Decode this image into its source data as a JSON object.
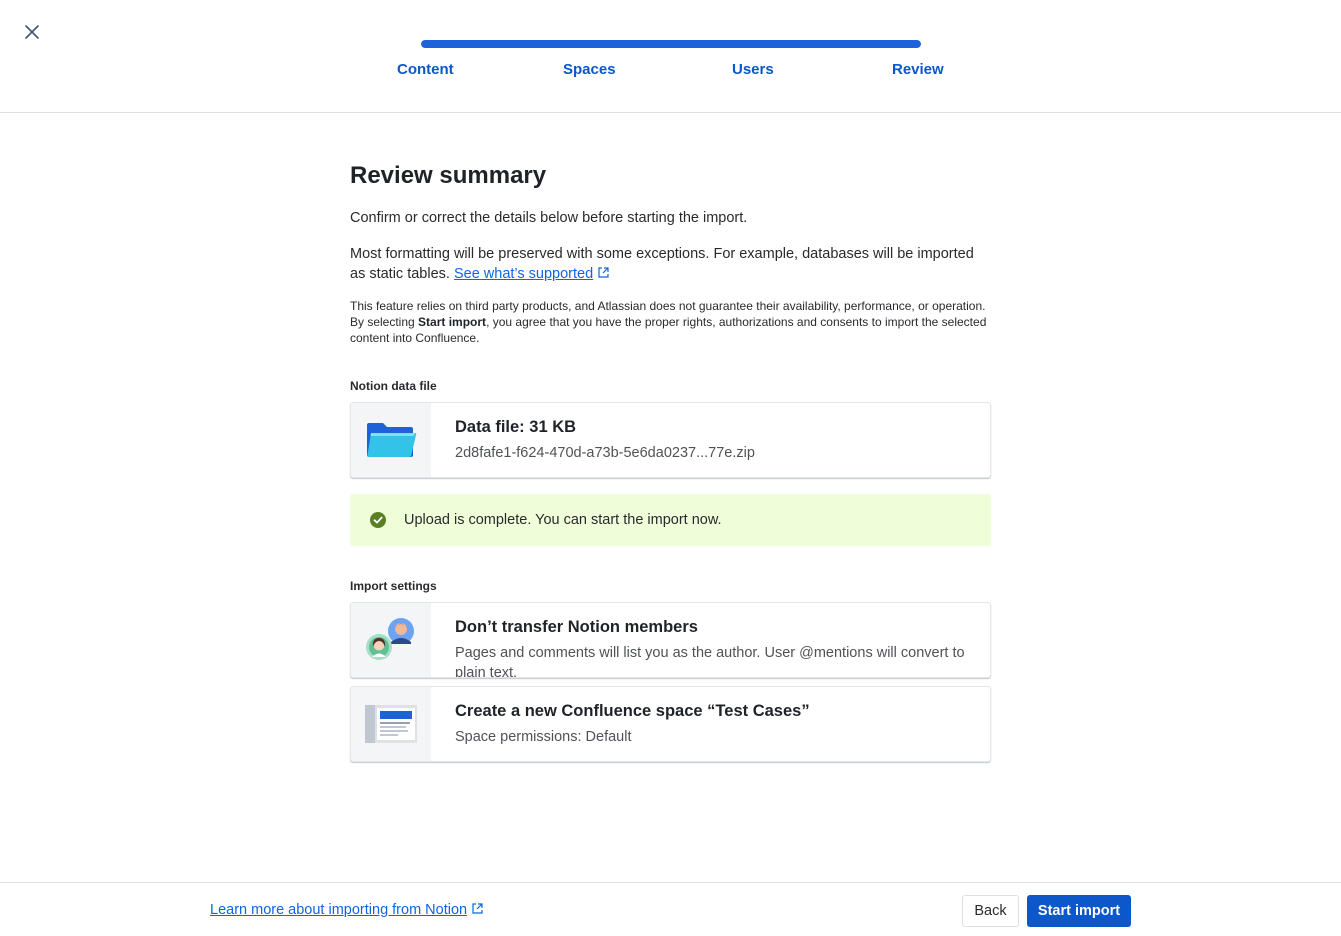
{
  "header": {
    "close_icon": "close-icon",
    "progress_percent": 100,
    "steps": [
      {
        "label": "Content"
      },
      {
        "label": "Spaces"
      },
      {
        "label": "Users"
      },
      {
        "label": "Review"
      }
    ]
  },
  "main": {
    "title": "Review summary",
    "intro": "Confirm or correct the details below before starting the import.",
    "formatting_note": "Most formatting will be preserved with some exceptions. For example, databases will be imported as static tables.",
    "supported_link": "See what’s supported",
    "disclaimer_before": "This feature relies on third party products, and Atlassian does not guarantee their availability, performance, or operation. By selecting ",
    "disclaimer_bold": "Start import",
    "disclaimer_after": ", you agree that you have the proper rights, authorizations and consents to import the selected content into Confluence.",
    "data_file_section": {
      "label": "Notion data file",
      "card_title": "Data file: 31 KB",
      "card_subtitle": "2d8fafe1-f624-470d-a73b-5e6da0237...77e.zip",
      "icon": "folder-icon"
    },
    "upload_status": {
      "text": "Upload is complete. You can start the import now.",
      "icon": "check-circle-icon",
      "color": "#5b7f24"
    },
    "import_settings": {
      "label": "Import settings",
      "items": [
        {
          "title": "Don’t transfer Notion members",
          "subtitle": "Pages and comments will list you as the author. User @mentions will convert to plain text.",
          "icon": "users-illustration-icon"
        },
        {
          "title": "Create a new Confluence space “Test Cases”",
          "subtitle": "Space permissions: Default",
          "icon": "space-illustration-icon"
        }
      ]
    }
  },
  "footer": {
    "learn_link": "Learn more about importing from Notion",
    "back_label": "Back",
    "start_label": "Start import"
  },
  "colors": {
    "accent": "#0c57c9",
    "link": "#0c66e4",
    "success_bg": "#effdd8"
  }
}
